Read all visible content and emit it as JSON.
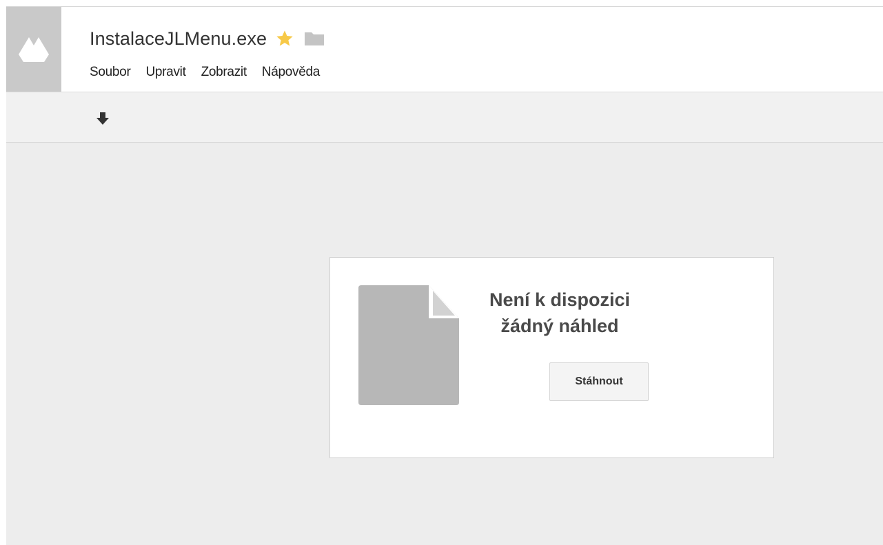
{
  "app": {
    "logo_icon": "google-drive-logo",
    "file_name": "InstalaceJLMenu.exe",
    "star_icon": "star-icon",
    "folder_icon": "folder-icon",
    "colors": {
      "star": "#f7c948",
      "folder": "#c4c4c4",
      "logo_tile": "#c9c9c9"
    }
  },
  "menu": {
    "items": [
      {
        "label": "Soubor"
      },
      {
        "label": "Upravit"
      },
      {
        "label": "Zobrazit"
      },
      {
        "label": "Nápověda"
      }
    ]
  },
  "toolbar": {
    "download_icon": "download-arrow-icon"
  },
  "preview": {
    "doc_icon": "generic-file-icon",
    "message": "Není k dispozici žádný náhled",
    "download_label": "Stáhnout"
  }
}
